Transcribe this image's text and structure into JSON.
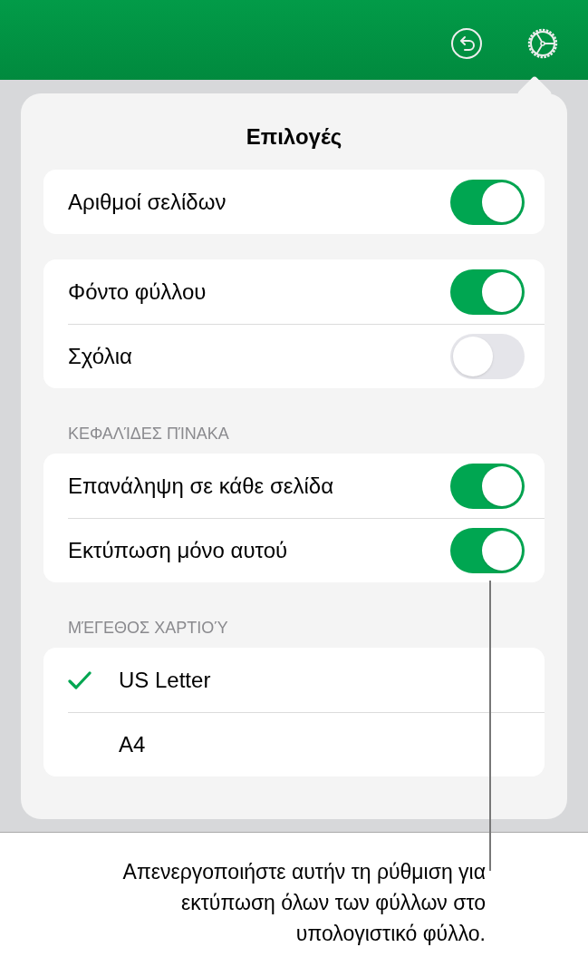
{
  "popover": {
    "title": "Επιλογές",
    "groups": [
      {
        "rows": [
          {
            "kind": "toggle",
            "label": "Αριθμοί σελίδων",
            "on": true
          }
        ]
      },
      {
        "rows": [
          {
            "kind": "toggle",
            "label": "Φόντο φύλλου",
            "on": true
          },
          {
            "kind": "toggle",
            "label": "Σχόλια",
            "on": false
          }
        ]
      },
      {
        "header": "ΚΕΦΑΛΊΔΕΣ ΠΊΝΑΚΑ",
        "rows": [
          {
            "kind": "toggle",
            "label": "Επανάληψη σε κάθε σελίδα",
            "on": true
          },
          {
            "kind": "toggle",
            "label": "Εκτύπωση μόνο αυτού",
            "on": true
          }
        ]
      },
      {
        "header": "ΜΈΓΕΘΟΣ ΧΑΡΤΙΟΎ",
        "rows": [
          {
            "kind": "choice",
            "label": "US Letter",
            "selected": true
          },
          {
            "kind": "choice",
            "label": "A4",
            "selected": false
          }
        ]
      }
    ]
  },
  "callout": "Απενεργοποιήστε αυτήν τη ρύθμιση για εκτύπωση όλων των φύλλων στο υπολογιστικό φύλλο."
}
